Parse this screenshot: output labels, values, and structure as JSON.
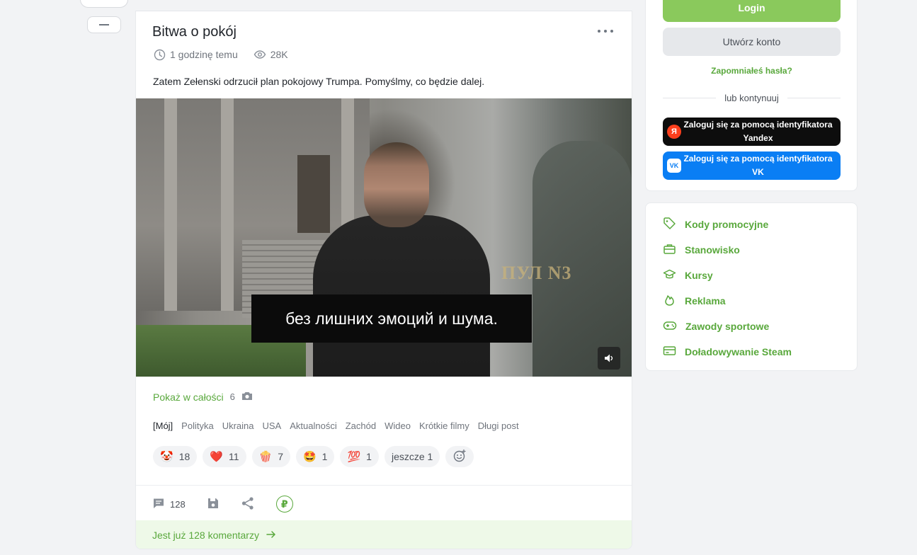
{
  "post": {
    "title": "Bitwa o pokój",
    "time": "1 godzinę temu",
    "views": "28K",
    "text": "Zatem Zełenski odrzucił plan pokojowy Trumpa. Pomyślmy, co będzie dalej.",
    "video": {
      "subtitle": "без лишних эмоций и шума.",
      "watermark": "ПУЛ N3"
    },
    "show_all": {
      "label": "Pokaż w całości",
      "photo_count": "6"
    },
    "tags": [
      "[Mój]",
      "Polityka",
      "Ukraina",
      "USA",
      "Aktualności",
      "Zachód",
      "Wideo",
      "Krótkie filmy",
      "Długi post"
    ],
    "reactions": [
      {
        "emoji": "🤡",
        "count": "18"
      },
      {
        "emoji": "❤️",
        "count": "11"
      },
      {
        "emoji": "🍿",
        "count": "7"
      },
      {
        "emoji": "🤩",
        "count": "1"
      },
      {
        "emoji": "💯",
        "count": "1"
      }
    ],
    "reactions_more": "jeszcze 1",
    "comment_count": "128",
    "donate_symbol": "₽",
    "comments_link": "Jest już 128 komentarzy"
  },
  "auth": {
    "login_label": "Login",
    "register_label": "Utwórz konto",
    "forgot_label": "Zapomniałeś hasła?",
    "or_label": "lub kontynuuj",
    "yandex_label": "Zaloguj się za pomocą identyfikatora Yandex",
    "yandex_logo": "Я",
    "vk_label": "Zaloguj się za pomocą identyfikatora VK",
    "vk_logo": "VK"
  },
  "sidebar_links": [
    {
      "label": "Kody promocyjne",
      "icon": "tag-icon"
    },
    {
      "label": "Stanowisko",
      "icon": "briefcase-icon"
    },
    {
      "label": "Kursy",
      "icon": "graduation-cap-icon"
    },
    {
      "label": "Reklama",
      "icon": "flame-icon"
    },
    {
      "label": "Zawody sportowe",
      "icon": "gamepad-icon"
    },
    {
      "label": "Doładowywanie Steam",
      "icon": "card-icon"
    }
  ],
  "colors": {
    "accent": "#59a83c",
    "login_button": "#8ac95c",
    "vk_blue": "#0a7ef4",
    "yandex_red": "#fc3f1d"
  }
}
